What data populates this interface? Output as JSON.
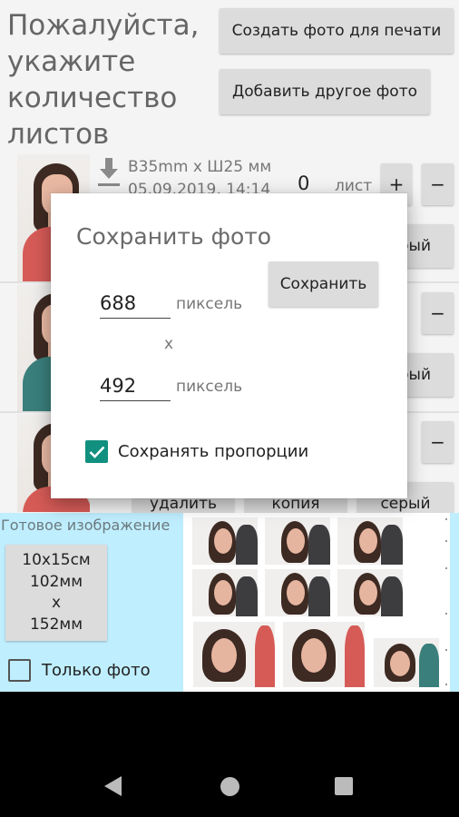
{
  "header": {
    "title": "Пожалуйста,\nукажите\nколичество\nлистов",
    "create_print_label": "Создать фото для печати",
    "add_photo_label": "Добавить другое фото"
  },
  "items": [
    {
      "size": "В35mm x Ш25 мм",
      "date": "05.09.2019, 14:14",
      "count": "0",
      "unit": "лист",
      "plus": "+",
      "minus": "−",
      "gray_label": "серый"
    },
    {
      "minus": "−",
      "gray_label": "серый"
    },
    {
      "minus": "−",
      "delete_label": "удалить",
      "copy_label": "копия",
      "gray_label": "серый"
    }
  ],
  "ready": {
    "label": "Готовое изображение",
    "size_lines": [
      "10x15см",
      "102мм",
      "x",
      "152мм"
    ],
    "only_photo_label": "Только фото"
  },
  "dialog": {
    "title": "Сохранить фото",
    "save_label": "Сохранить",
    "width_value": "688",
    "height_value": "492",
    "unit": "пиксель",
    "separator": "x",
    "keep_proportions_label": "Сохранять пропорции",
    "keep_proportions_checked": true
  },
  "colors": {
    "accent": "#11907f",
    "ready_panel": "#bfeefe",
    "button": "#dcdcdc"
  },
  "icons": {
    "download": "download-icon",
    "back": "nav-back-icon",
    "home": "nav-home-icon",
    "recent": "nav-recent-icon"
  }
}
